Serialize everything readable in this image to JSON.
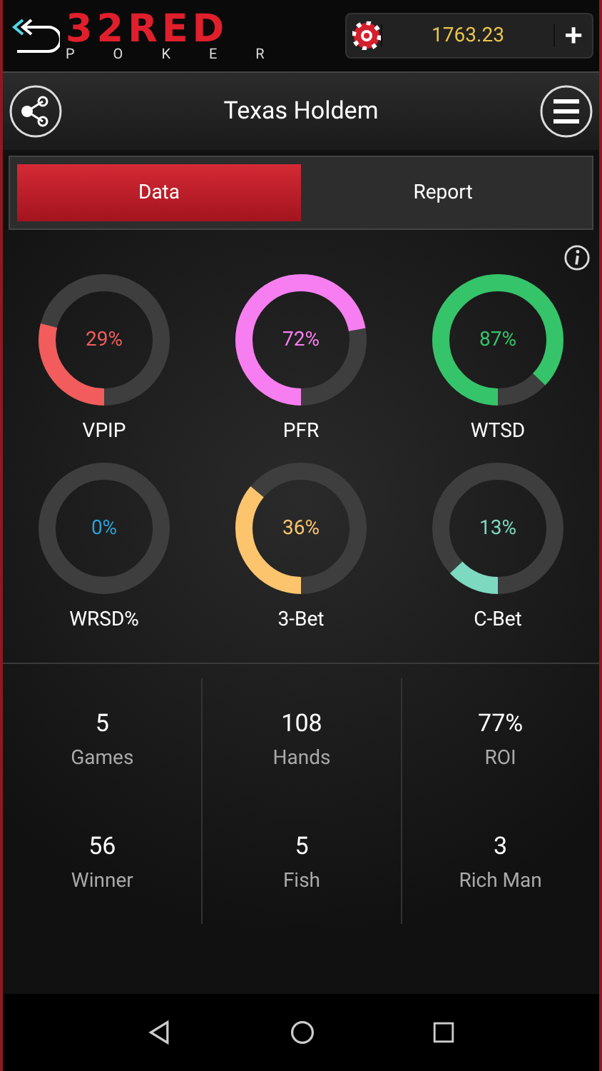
{
  "header": {
    "logo_top": "32RED",
    "logo_bottom": "POKER",
    "balance": "1763.23",
    "add_button": "+"
  },
  "title_bar": {
    "title": "Texas Holdem"
  },
  "tabs": [
    {
      "label": "Data",
      "selected": true
    },
    {
      "label": "Report",
      "selected": false
    }
  ],
  "rings": [
    {
      "value": "29%",
      "label": "VPIP",
      "level": 0.29,
      "color": "#f25c5c"
    },
    {
      "value": "72%",
      "label": "PFR",
      "level": 0.72,
      "color": "#f77ef0"
    },
    {
      "value": "87%",
      "label": "WTSD",
      "level": 0.87,
      "color": "#35c46a"
    },
    {
      "value": "0%",
      "label": "WRSD%",
      "level": 0,
      "color": "#2a9fd6"
    },
    {
      "value": "36%",
      "label": "3-Bet",
      "level": 0.36,
      "color": "#fdc46e"
    },
    {
      "value": "13%",
      "label": "C-Bet",
      "level": 0.13,
      "color": "#7dd9c0"
    }
  ],
  "stats": [
    {
      "value": "5",
      "label": "Games"
    },
    {
      "value": "108",
      "label": "Hands"
    },
    {
      "value": "77%",
      "label": "ROI"
    },
    {
      "value": "56",
      "label": "Winner"
    },
    {
      "value": "5",
      "label": "Fish"
    },
    {
      "value": "3",
      "label": "Rich Man"
    }
  ]
}
